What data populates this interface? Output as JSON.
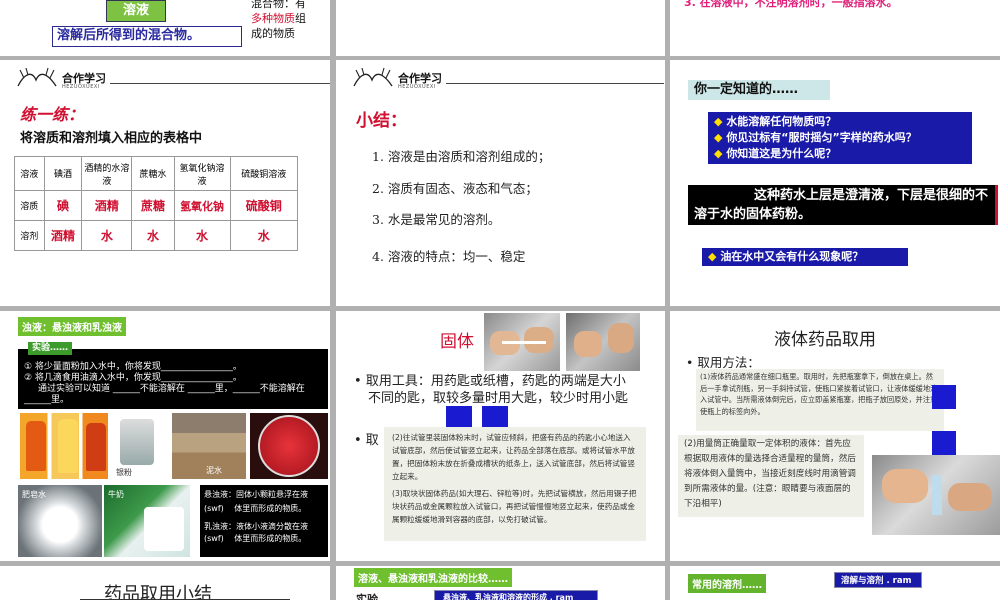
{
  "s1": {
    "badge": "溶液",
    "definition": "溶解后所得到的混合物。",
    "right_line1": "混合物：有",
    "right_line2a": "多种物质",
    "right_line2b": "组",
    "right_line3": "成的物质"
  },
  "s3": {
    "text": "3. 在溶液中，不注明溶剂时，一般指溶水。"
  },
  "s4": {
    "header": "合作学习",
    "header_sub": "HEZUOXUEXI",
    "title": "练一练：",
    "instruction": "将溶质和溶剂填入相应的表格中",
    "cols": [
      "溶液",
      "碘酒",
      "酒精的水溶液",
      "蔗糖水",
      "氢氧化钠溶液",
      "硫酸铜溶液"
    ],
    "row1": [
      "溶质",
      "碘",
      "酒精",
      "蔗糖",
      "氢氧化钠",
      "硫酸铜"
    ],
    "row2": [
      "溶剂",
      "酒精",
      "水",
      "水",
      "水",
      "水"
    ]
  },
  "s5": {
    "header": "合作学习",
    "header_sub": "HEZUOXUEXI",
    "title": "小结：",
    "items": [
      "1. 溶液是由溶质和溶剂组成的；",
      "2. 溶质有固态、液态和气态；",
      "3. 水是最常见的溶剂。",
      "4. 溶液的特点：均一、稳定"
    ]
  },
  "s6": {
    "title": "你一定知道的……",
    "q1": "水能溶解任何物质吗？",
    "q2": "你见过标有“服时摇匀”字样的药水吗？",
    "q3": "你知道这是为什么呢？",
    "answer": "这种药水上层是澄清液，下层是很细的不溶于水的固体药粉。",
    "q4": "油在水中又会有什么现象呢？"
  },
  "s7": {
    "label": "浊液：悬浊液和乳浊液",
    "exp_label": "实验……",
    "exp1": "① 将少量面粉加入水中，你将发现________________。",
    "exp2": "② 将几滴食用油滴入水中，你发现________________。",
    "exp3": "通过实验可以知道 ______不能溶解在 ______里，______不能溶解在______里。",
    "cap_muddy": "泥水",
    "cap_soap": "肥皂水",
    "cap_milk": "牛奶",
    "cap_silver": "银粉",
    "def1": "悬浊液：固体小颗粒悬浮在液",
    "def1b": "(swf)　 体里而形成的物质。",
    "def2": "乳浊液：液体小液滴分散在液",
    "def2b": "(swf)　 体里而形成的物质。"
  },
  "s8": {
    "title": "固体",
    "bullet1": "取用工具：用药匙或纸槽，药匙的两端是大小不同的匙，取较多量时用大匙，较少时用小匙",
    "note1": "(2)往试管里装固体粉末时，试管应倾斜，把盛有药品的药匙小心地送入试管底部，然后使试管竖立起来，让药品全部落在底部。或将试管水平放置，把固体粉末放在折叠成槽状的纸条上，送入试管底部，然后将试管竖立起来。",
    "note2": "(3)取块状固体药品(如大理石、锌粒等)时，先把试管横放，然后用镊子把块状药品或金属颗粒放入试管口，再把试管慢慢地竖立起来，使药品或金属颗粒缓缓地滑到容器的底部，以免打破试管。"
  },
  "s9": {
    "title": "液体药品取用",
    "bullet": "取用方法：",
    "text1": "(1)液体药品通常盛在细口瓶里。取用时，先把瓶塞拿下，倒放在桌上。然后一手拿试剂瓶，另一手斜持试管，使瓶口紧挨着试管口，让液体缓缓地流入试管中。当所需液体倒完后，应立即盖紧瓶塞，把瓶子放回原处，并注意使瓶上的标签向外。",
    "text2": "(2)用量筒正确量取一定体积的液体：首先应根据取用液体的量选择合适量程的量筒，然后将液体倒入量筒中，当接近刻度线时用滴管调到所需液体的量。(注意：眼睛要与液面层的下沿相平)"
  },
  "s10": {
    "title": "药品取用小结"
  },
  "s11": {
    "label": "溶液、悬浊液和乳浊液的比较……",
    "exp": "实验……",
    "box": "悬浊液、乳浊液和溶液的形成 . ram"
  },
  "s12": {
    "label": "常用的溶剂……",
    "box": "溶解与溶剂 . ram"
  }
}
